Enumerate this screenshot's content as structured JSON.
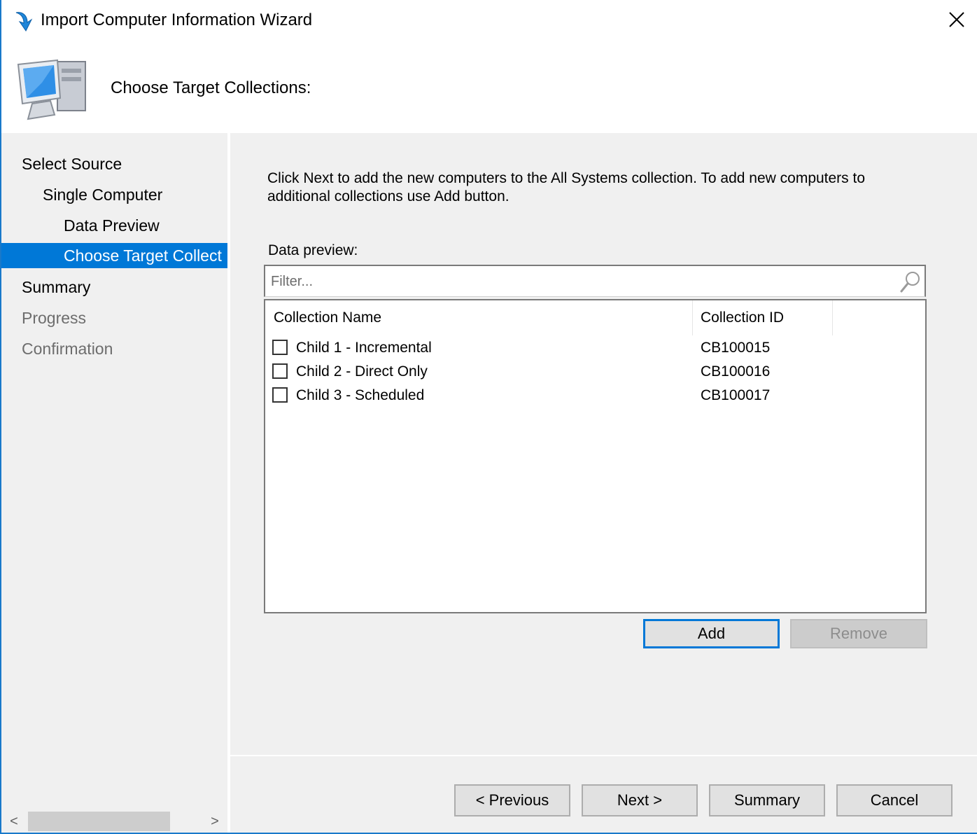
{
  "window": {
    "title": "Import Computer Information Wizard",
    "accent_color": "#0078d7",
    "icons": {
      "title": "wizard-arrow-icon",
      "header": "computer-icon",
      "close": "close-icon"
    }
  },
  "header": {
    "title": "Choose Target Collections:"
  },
  "nav": {
    "items": [
      {
        "label": "Select Source",
        "state": "normal"
      },
      {
        "label": "Single Computer",
        "state": "normal"
      },
      {
        "label": "Data Preview",
        "state": "normal"
      },
      {
        "label": "Choose Target Collect",
        "state": "selected"
      },
      {
        "label": "Summary",
        "state": "normal"
      },
      {
        "label": "Progress",
        "state": "disabled"
      },
      {
        "label": "Confirmation",
        "state": "disabled"
      }
    ],
    "scroll_left": "<",
    "scroll_right": ">"
  },
  "main": {
    "info_text": "Click Next to add the new computers to the All Systems collection. To add new computers to additional collections use Add button.",
    "data_preview_label": "Data preview:",
    "filter": {
      "value": "",
      "placeholder": "Filter..."
    },
    "columns": [
      "Collection Name",
      "Collection ID"
    ],
    "rows": [
      {
        "name": "Child 1 - Incremental",
        "id": "CB100015",
        "checked": false
      },
      {
        "name": "Child 2 - Direct Only",
        "id": "CB100016",
        "checked": false
      },
      {
        "name": "Child 3 - Scheduled",
        "id": "CB100017",
        "checked": false
      }
    ],
    "add_label": "Add",
    "remove_label": "Remove"
  },
  "footer": {
    "previous_label": "< Previous",
    "next_label": "Next >",
    "summary_label": "Summary",
    "cancel_label": "Cancel"
  }
}
